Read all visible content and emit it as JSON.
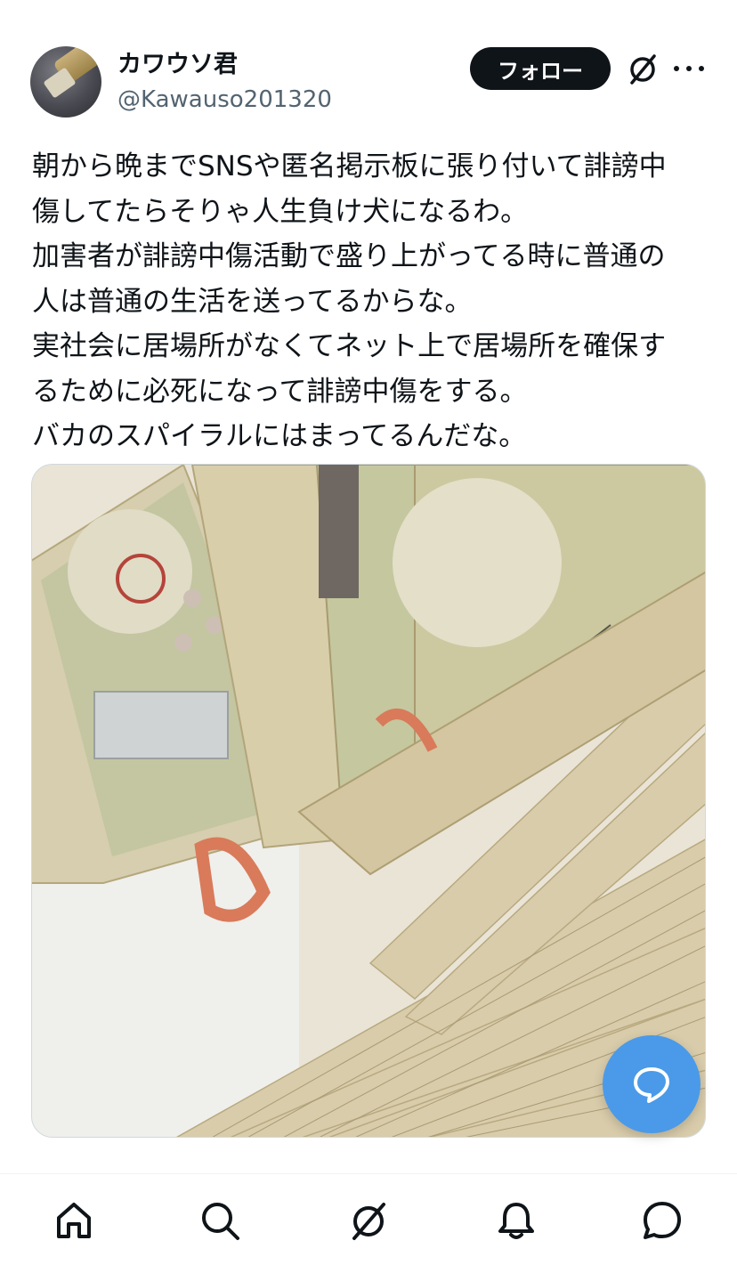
{
  "header": {
    "display_name": "カワウソ君",
    "handle": "@Kawauso201320",
    "follow_label": "フォロー",
    "avatar_icon": "otter-avatar",
    "grok_icon": "grok-icon",
    "more_icon": "more-icon"
  },
  "post": {
    "lines": [
      "朝から晩までSNSや匿名掲示板に張り付いて誹謗中",
      "傷してたらそりゃ人生負け犬になるわ。",
      "加害者が誹謗中傷活動で盛り上がってる時に普通の",
      "人は普通の生活を送ってるからな。",
      "実社会に居場所がなくてネット上で居場所を確保す",
      "るために必死になって誹謗中傷をする。",
      "バカのスパイラルにはまってるんだな。"
    ],
    "media_icon": "banknotes-photo"
  },
  "reply_button": {
    "icon": "reply-bubble-icon",
    "color": "#4a9ae9"
  },
  "tabbar": {
    "items": [
      {
        "icon": "home-icon"
      },
      {
        "icon": "search-icon"
      },
      {
        "icon": "grok-icon"
      },
      {
        "icon": "notifications-icon"
      },
      {
        "icon": "messages-icon"
      }
    ]
  },
  "colors": {
    "text": "#0f1419",
    "secondary": "#536471",
    "accent": "#4a9ae9"
  }
}
